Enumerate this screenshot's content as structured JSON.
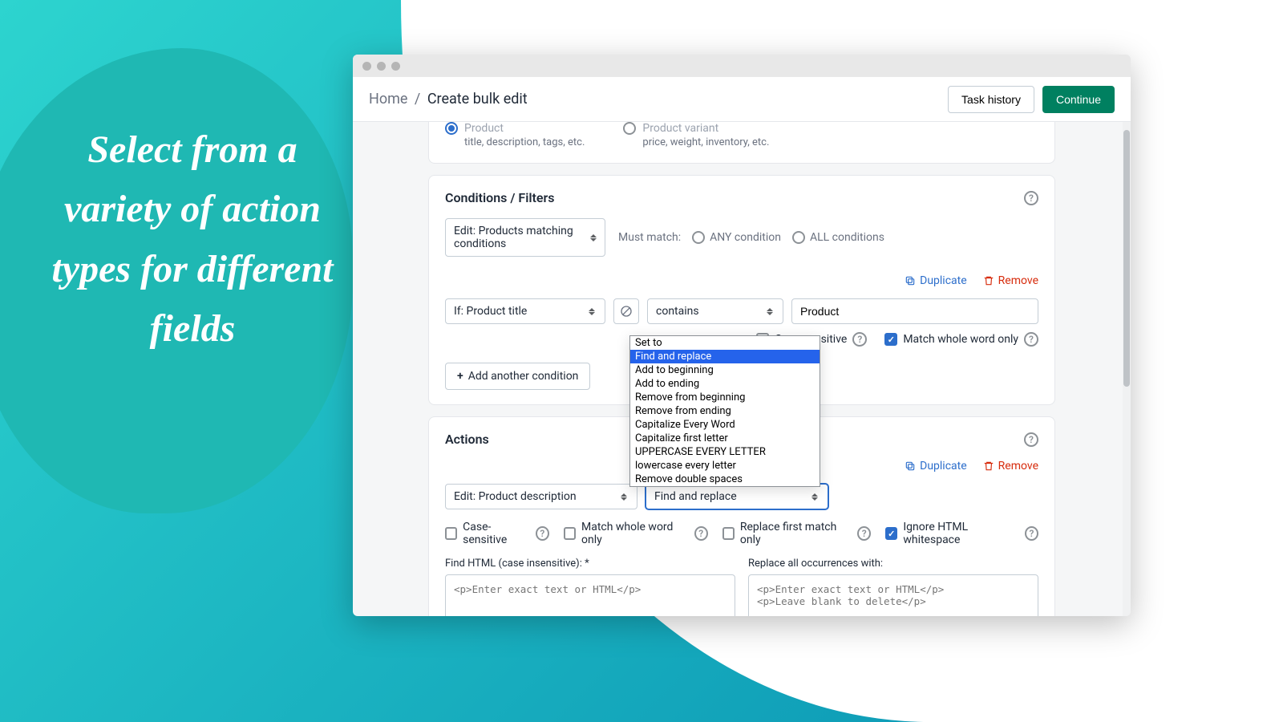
{
  "headline": "Select from a variety of action types for different fields",
  "breadcrumb": {
    "home": "Home",
    "current": "Create bulk edit"
  },
  "header": {
    "task_history": "Task history",
    "continue": "Continue"
  },
  "product_row": {
    "opt1_label": "Product",
    "opt1_sub": "title, description, tags, etc.",
    "opt2_label": "Product variant",
    "opt2_sub": "price, weight, inventory, etc."
  },
  "conditions": {
    "title": "Conditions / Filters",
    "edit_select": "Edit: Products matching conditions",
    "must_match": "Must match:",
    "any": "ANY condition",
    "all": "ALL conditions",
    "duplicate": "Duplicate",
    "remove": "Remove",
    "if_select": "If: Product title",
    "op_select": "contains",
    "value": "Product",
    "case_sensitive": "Case-sensitive",
    "whole_word": "Match whole word only",
    "add_condition": "Add another condition"
  },
  "actions": {
    "title": "Actions",
    "duplicate": "Duplicate",
    "remove": "Remove",
    "edit_select": "Edit: Product description",
    "action_select": "Find and replace",
    "case_sensitive": "Case-sensitive",
    "whole_word": "Match whole word only",
    "first_match": "Replace first match only",
    "ignore_ws": "Ignore HTML whitespace",
    "find_label": "Find HTML (case insensitive): *",
    "find_placeholder": "<p>Enter exact text or HTML</p>",
    "replace_label": "Replace all occurrences with:",
    "replace_placeholder": "<p>Enter exact text or HTML</p>\n<p>Leave blank to delete</p>"
  },
  "dropdown": {
    "items": [
      "Set to",
      "Find and replace",
      "Add to beginning",
      "Add to ending",
      "Remove from beginning",
      "Remove from ending",
      "Capitalize Every Word",
      "Capitalize first letter",
      "UPPERCASE EVERY LETTER",
      "lowercase every letter",
      "Remove double spaces"
    ],
    "selected_index": 1
  }
}
